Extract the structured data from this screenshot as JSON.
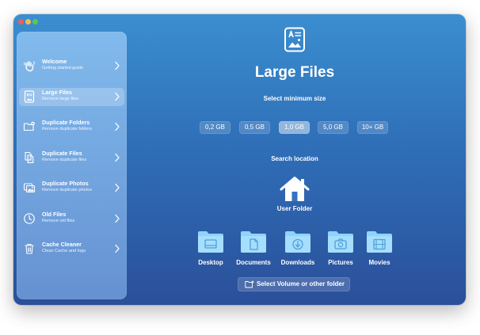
{
  "sidebar": {
    "items": [
      {
        "title": "Welcome",
        "subtitle": "Getting started guide",
        "icon": "wave-hand-icon"
      },
      {
        "title": "Large Files",
        "subtitle": "Remove large files",
        "icon": "large-file-icon"
      },
      {
        "title": "Duplicate Folders",
        "subtitle": "Remove duplicate folders",
        "icon": "duplicate-folder-icon"
      },
      {
        "title": "Duplicate Files",
        "subtitle": "Remove duplicate files",
        "icon": "duplicate-files-icon"
      },
      {
        "title": "Duplicate Photos",
        "subtitle": "Remove duplicate photos",
        "icon": "duplicate-photos-icon"
      },
      {
        "title": "Old Files",
        "subtitle": "Remove old files",
        "icon": "clock-icon"
      },
      {
        "title": "Cache Cleaner",
        "subtitle": "Clean Cache and logs",
        "icon": "trash-icon"
      }
    ],
    "active_index": 1
  },
  "main": {
    "title": "Large Files",
    "size_label": "Select minimum size",
    "sizes": [
      "0,2 GB",
      "0,5 GB",
      "1,0 GB",
      "5,0 GB",
      "10+ GB"
    ],
    "selected_size": "1,0 GB",
    "location_label": "Search location",
    "home_label": "User Folder",
    "folders": [
      {
        "label": "Desktop",
        "icon": "desktop-folder-icon"
      },
      {
        "label": "Documents",
        "icon": "documents-folder-icon"
      },
      {
        "label": "Downloads",
        "icon": "downloads-folder-icon"
      },
      {
        "label": "Pictures",
        "icon": "pictures-folder-icon"
      },
      {
        "label": "Movies",
        "icon": "movies-folder-icon"
      }
    ],
    "volume_button": "Select Volume or other folder"
  },
  "colors": {
    "window_top": "#3b8ed0",
    "window_bottom": "#2b4f9a",
    "folder_blue": "#8fd3fb"
  }
}
